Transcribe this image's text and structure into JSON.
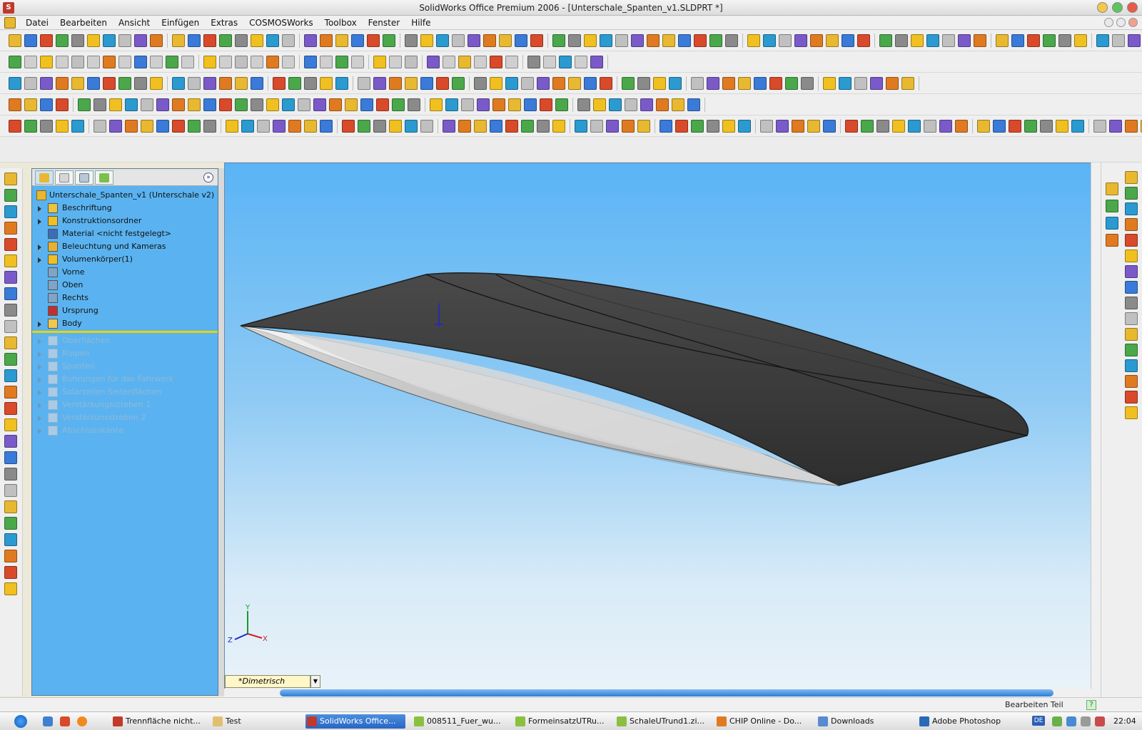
{
  "window": {
    "title": "SolidWorks Office Premium 2006 - [Unterschale_Spanten_v1.SLDPRT *]",
    "app_icon": "solidworks-logo-icon"
  },
  "menu": {
    "items": [
      "Datei",
      "Bearbeiten",
      "Ansicht",
      "Einfügen",
      "Extras",
      "COSMOSWorks",
      "Toolbox",
      "Fenster",
      "Hilfe"
    ]
  },
  "feature_tree": {
    "tabs": [
      "feature-manager-icon",
      "property-manager-icon",
      "configuration-manager-icon",
      "dimxpert-icon"
    ],
    "root": "Unterschale_Spanten_v1  (Unterschale v2)",
    "items": [
      {
        "label": "Beschriftung",
        "expander": true,
        "icon": "annotation-icon",
        "color": "#e8c440"
      },
      {
        "label": "Konstruktionsordner",
        "expander": true,
        "icon": "design-folder-icon",
        "color": "#f0c020"
      },
      {
        "label": "Material <nicht festgelegt>",
        "expander": false,
        "icon": "material-icon",
        "color": "#3a6fb8"
      },
      {
        "label": "Beleuchtung und Kameras",
        "expander": true,
        "icon": "lights-cameras-icon",
        "color": "#e8b030"
      },
      {
        "label": "Volumenkörper(1)",
        "expander": true,
        "icon": "solid-bodies-icon",
        "color": "#f0c020"
      },
      {
        "label": "Vorne",
        "expander": false,
        "icon": "plane-icon",
        "color": "#7fa4c8"
      },
      {
        "label": "Oben",
        "expander": false,
        "icon": "plane-icon",
        "color": "#7fa4c8"
      },
      {
        "label": "Rechts",
        "expander": false,
        "icon": "plane-icon",
        "color": "#7fa4c8"
      },
      {
        "label": "Ursprung",
        "expander": false,
        "icon": "origin-icon",
        "color": "#c03030"
      },
      {
        "label": "Body",
        "expander": true,
        "icon": "folder-icon",
        "color": "#f2c84a"
      }
    ],
    "suppressed": [
      "Oberflächen",
      "Rippen",
      "Spanten",
      "Bohrungen für das Fahrwerk",
      "Solarzellen Seitenflächen",
      "Verstärkungsstreben 1",
      "Verstärkunsstreben 2",
      "Abschlusskante"
    ]
  },
  "viewport": {
    "view_name": "*Dimetrisch",
    "triad": {
      "x": "X",
      "y": "Y",
      "z": "Z"
    },
    "colors": {
      "model_top": "#3e3e3e",
      "model_side": "#dcdcdc",
      "sky_top": "#5ab4f5",
      "sky_bottom": "#e9f2f9"
    }
  },
  "status": {
    "mode": "Bearbeiten Teil"
  },
  "taskbar": {
    "tasks": [
      {
        "label": "Trennfläche nicht...",
        "icon": "browser-icon",
        "active": false
      },
      {
        "label": "Test",
        "icon": "folder-icon",
        "active": false
      },
      {
        "label": "SolidWorks Office...",
        "icon": "solidworks-icon",
        "active": true
      },
      {
        "label": "008511_Fuer_wu...",
        "icon": "document-icon",
        "active": false
      },
      {
        "label": "FormeinsatzUTRu...",
        "icon": "document-icon",
        "active": false
      },
      {
        "label": "SchaleUTrund1.zi...",
        "icon": "zip-icon",
        "active": false
      },
      {
        "label": "CHIP Online - Do...",
        "icon": "firefox-icon",
        "active": false
      },
      {
        "label": "Downloads",
        "icon": "downloads-icon",
        "active": false
      },
      {
        "label": "Adobe Photoshop",
        "icon": "photoshop-icon",
        "active": false
      }
    ],
    "language": "DE",
    "clock": "22:04"
  }
}
